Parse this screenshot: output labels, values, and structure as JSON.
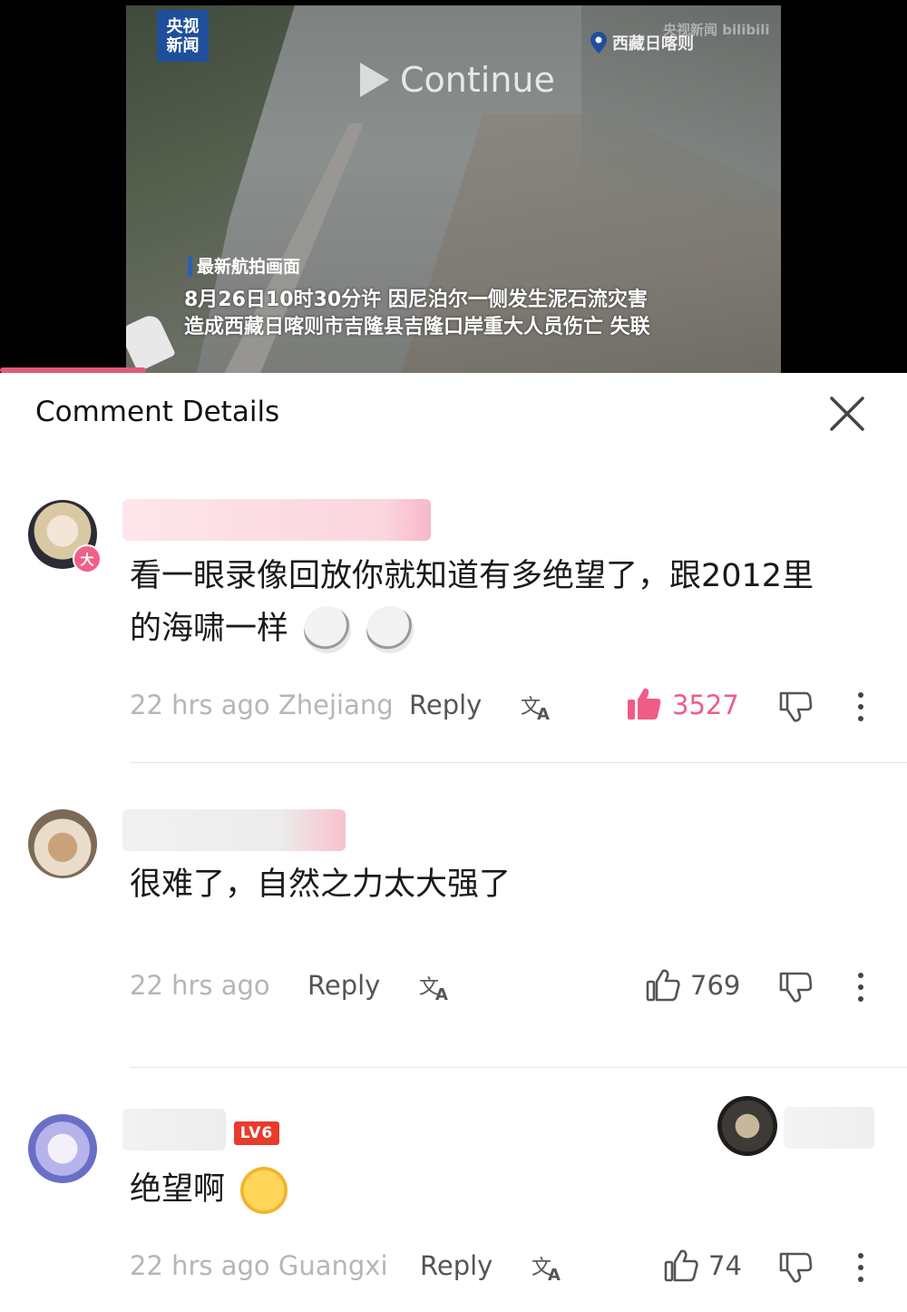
{
  "video": {
    "channel_logo": "央视\n新闻",
    "location": "西藏日喀则",
    "watermark": "央视新闻 bilibili",
    "continue_label": "Continue",
    "caption_tag": "最新航拍画面",
    "caption_line1": "8月26日10时30分许 因尼泊尔一侧发生泥石流灾害",
    "caption_line2": "造成西藏日喀则市吉隆县吉隆口岸重大人员伤亡 失联"
  },
  "panel": {
    "title": "Comment Details"
  },
  "comments": [
    {
      "badge": "大",
      "text_line1": "看一眼录像回放你就知道有多绝望了，跟2012里",
      "text_line2": "的海啸一样",
      "meta": "22 hrs ago Zhejiang",
      "reply_label": "Reply",
      "likes": "3527",
      "liked": true
    },
    {
      "text_line1": "很难了，自然之力太大强了",
      "meta": "22 hrs ago",
      "reply_label": "Reply",
      "likes": "769",
      "liked": false
    },
    {
      "level": "LV6",
      "text_line1": "绝望啊",
      "meta": "22 hrs ago Guangxi",
      "reply_label": "Reply",
      "likes": "74",
      "liked": false
    }
  ],
  "colors": {
    "accent": "#f05c84",
    "progress": "#e05a79",
    "level": "#e83b2c"
  },
  "icons": [
    "close-icon",
    "translate-icon",
    "thumbs-up-icon",
    "thumbs-down-icon",
    "more-icon",
    "location-pin-icon",
    "play-icon"
  ]
}
